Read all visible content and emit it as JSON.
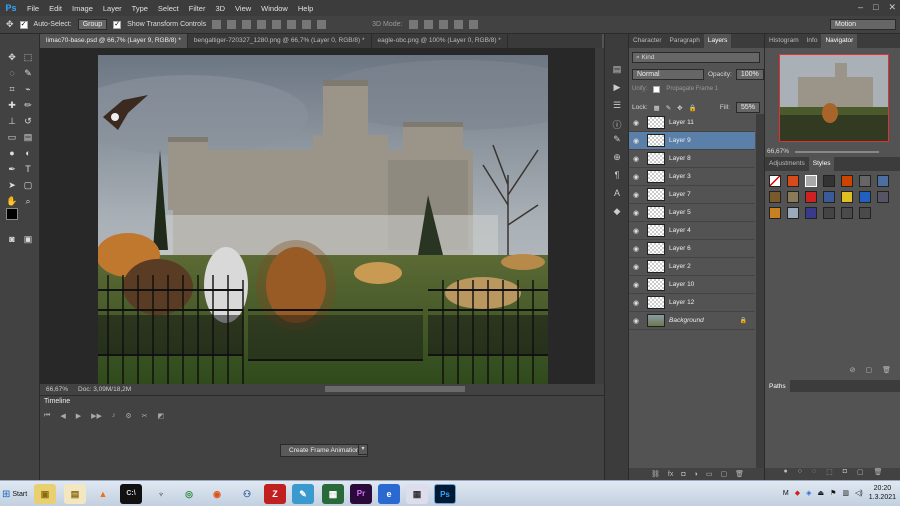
{
  "app": {
    "logo": "Ps"
  },
  "menu": [
    "File",
    "Edit",
    "Image",
    "Layer",
    "Type",
    "Select",
    "Filter",
    "3D",
    "View",
    "Window",
    "Help"
  ],
  "options": {
    "auto_select_label": "Auto-Select:",
    "auto_select_value": "Group",
    "transform_label": "Show Transform Controls",
    "mode_3d_label": "3D Mode:",
    "workspace": "Motion"
  },
  "doc_tabs": [
    "limac70-base.psd @ 66,7% (Layer 9, RGB/8) *",
    "bengaltiger-720327_1280.png @ 66,7% (Layer 0, RGB/8) *",
    "eagle-obc.png @ 100% (Layer 0, RGB/8) *"
  ],
  "status": {
    "zoom": "66,67%",
    "doc": "Doc: 3,09M/18,2M"
  },
  "timeline": {
    "tab": "Timeline",
    "create_button": "Create Frame Animation"
  },
  "layers_panel": {
    "tabs": [
      "Character",
      "Paragraph",
      "Layers"
    ],
    "active_tab": "Layers",
    "kind": "Kind",
    "blend_mode": "Normal",
    "opacity_label": "Opacity:",
    "opacity_value": "100%",
    "unify_label": "Unify:",
    "propagate_label": "Propagate Frame 1",
    "lock_label": "Lock:",
    "fill_label": "Fill:",
    "fill_value": "55%",
    "layers": [
      {
        "name": "Layer 11",
        "selected": false
      },
      {
        "name": "Layer 9",
        "selected": true
      },
      {
        "name": "Layer 8",
        "selected": false
      },
      {
        "name": "Layer 3",
        "selected": false
      },
      {
        "name": "Layer 7",
        "selected": false
      },
      {
        "name": "Layer 5",
        "selected": false
      },
      {
        "name": "Layer 4",
        "selected": false
      },
      {
        "name": "Layer 6",
        "selected": false
      },
      {
        "name": "Layer 2",
        "selected": false
      },
      {
        "name": "Layer 10",
        "selected": false
      },
      {
        "name": "Layer 12",
        "selected": false
      },
      {
        "name": "Background",
        "selected": false
      }
    ]
  },
  "right_panel": {
    "tabs": [
      "Histogram",
      "Info",
      "Navigator"
    ],
    "active_tab": "Navigator",
    "zoom": "66,67%",
    "style_tabs": [
      "Adjustments",
      "Styles"
    ],
    "paths_tab": "Paths"
  },
  "taskbar": {
    "start_label": "Start",
    "apps": [
      "explorer",
      "vlc",
      "cmd",
      "alien",
      "chrome",
      "firefox",
      "network",
      "filezilla",
      "notepad",
      "gimp",
      "premiere",
      "browser",
      "calc",
      "photoshop"
    ],
    "time": "20:20",
    "date": "1.3.2021",
    "lang": "M"
  },
  "colors": {
    "accent": "#31a8ff",
    "selected_layer": "#5a7fa8",
    "panel_bg": "#535353"
  }
}
